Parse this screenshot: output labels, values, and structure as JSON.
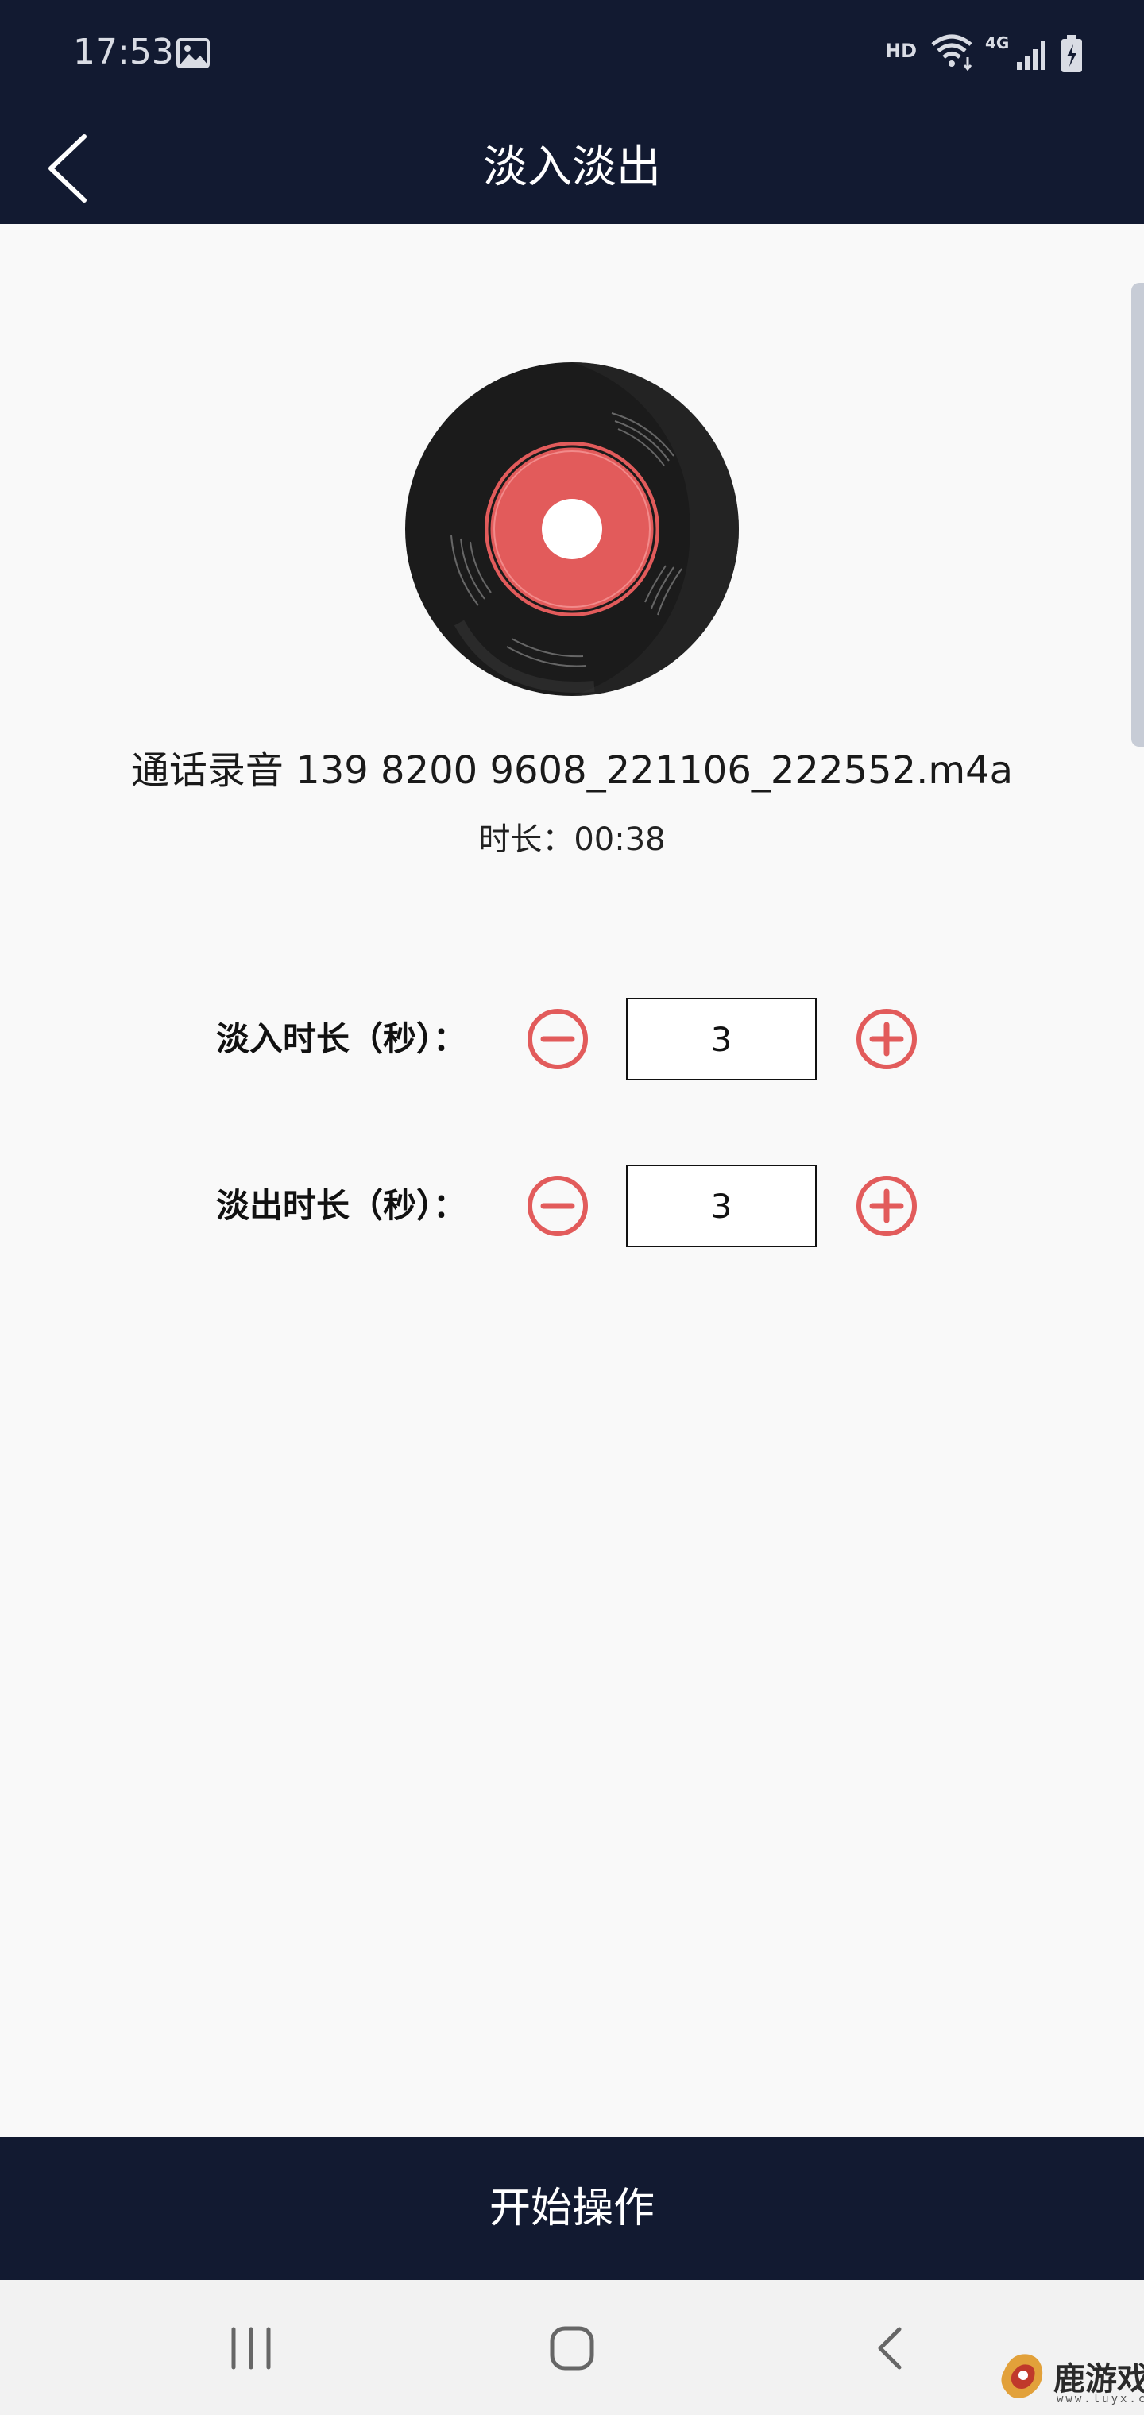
{
  "status_bar": {
    "time": "17:53",
    "hd_label": "HD",
    "network_label": "4G",
    "icons": [
      "gallery-icon",
      "wifi-icon",
      "signal-icon",
      "battery-charging-icon"
    ]
  },
  "header": {
    "title": "淡入淡出",
    "back_icon": "chevron-left-icon"
  },
  "file": {
    "name": "通话录音 139 8200 9608_221106_222552.m4a",
    "duration": "时长：00:38"
  },
  "settings": {
    "fade_in": {
      "label": "淡入时长（秒）：",
      "value": "3"
    },
    "fade_out": {
      "label": "淡出时长（秒）：",
      "value": "3"
    }
  },
  "actions": {
    "start_label": "开始操作"
  },
  "nav_bar": {
    "icons": [
      "recent-apps-icon",
      "home-icon",
      "back-icon"
    ]
  },
  "watermark": {
    "text": "鹿游戏",
    "url": "www.luyx.cn"
  },
  "colors": {
    "header_bg": "#121a31",
    "accent_red": "#e25b5b",
    "page_bg": "#f9f9f9"
  }
}
